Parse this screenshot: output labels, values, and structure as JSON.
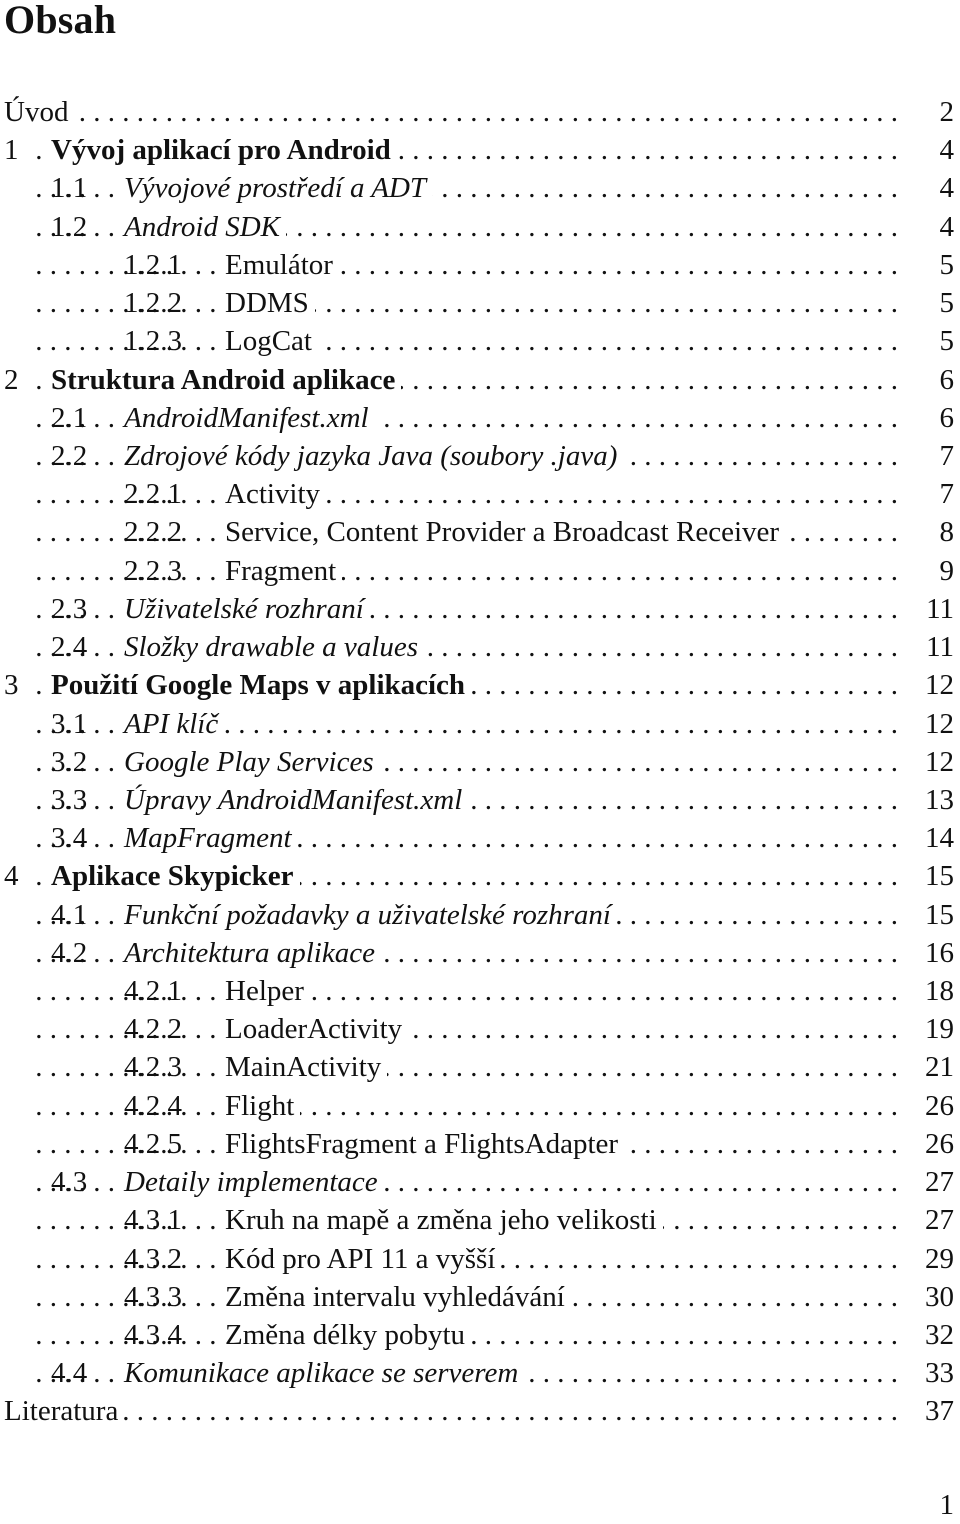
{
  "page": {
    "title": "Obsah",
    "footer_page_number": "1"
  },
  "toc": [
    {
      "level": 0,
      "number": "",
      "title": "Úvod",
      "page": "2"
    },
    {
      "level": 1,
      "number": "1",
      "title": "Vývoj aplikací pro Android",
      "page": "4"
    },
    {
      "level": 2,
      "number": "1.1",
      "title": "Vývojové prostředí a ADT",
      "page": "4"
    },
    {
      "level": 2,
      "number": "1.2",
      "title": "Android SDK",
      "page": "4"
    },
    {
      "level": 3,
      "number": "1.2.1",
      "title": "Emulátor",
      "page": "5"
    },
    {
      "level": 3,
      "number": "1.2.2",
      "title": "DDMS",
      "page": "5"
    },
    {
      "level": 3,
      "number": "1.2.3",
      "title": "LogCat",
      "page": "5"
    },
    {
      "level": 1,
      "number": "2",
      "title": "Struktura Android aplikace",
      "page": "6"
    },
    {
      "level": 2,
      "number": "2.1",
      "title": "AndroidManifest.xml",
      "page": "6"
    },
    {
      "level": 2,
      "number": "2.2",
      "title": "Zdrojové kódy jazyka Java (soubory .java)",
      "page": "7"
    },
    {
      "level": 3,
      "number": "2.2.1",
      "title": "Activity",
      "page": "7"
    },
    {
      "level": 3,
      "number": "2.2.2",
      "title": "Service, Content Provider a Broadcast Receiver",
      "page": "8"
    },
    {
      "level": 3,
      "number": "2.2.3",
      "title": "Fragment",
      "page": "9"
    },
    {
      "level": 2,
      "number": "2.3",
      "title": "Uživatelské rozhraní",
      "page": "11"
    },
    {
      "level": 2,
      "number": "2.4",
      "title": "Složky drawable a values",
      "page": "11"
    },
    {
      "level": 1,
      "number": "3",
      "title": "Použití Google Maps v aplikacích",
      "page": "12"
    },
    {
      "level": 2,
      "number": "3.1",
      "title": "API klíč",
      "page": "12"
    },
    {
      "level": 2,
      "number": "3.2",
      "title": "Google Play Services",
      "page": "12"
    },
    {
      "level": 2,
      "number": "3.3",
      "title": "Úpravy AndroidManifest.xml",
      "page": "13"
    },
    {
      "level": 2,
      "number": "3.4",
      "title": "MapFragment",
      "page": "14"
    },
    {
      "level": 1,
      "number": "4",
      "title": "Aplikace Skypicker",
      "page": "15"
    },
    {
      "level": 2,
      "number": "4.1",
      "title": "Funkční požadavky a uživatelské rozhraní",
      "page": "15"
    },
    {
      "level": 2,
      "number": "4.2",
      "title": "Architektura aplikace",
      "page": "16"
    },
    {
      "level": 3,
      "number": "4.2.1",
      "title": "Helper",
      "page": "18"
    },
    {
      "level": 3,
      "number": "4.2.2",
      "title": "LoaderActivity",
      "page": "19"
    },
    {
      "level": 3,
      "number": "4.2.3",
      "title": "MainActivity",
      "page": "21"
    },
    {
      "level": 3,
      "number": "4.2.4",
      "title": "Flight",
      "page": "26"
    },
    {
      "level": 3,
      "number": "4.2.5",
      "title": "FlightsFragment a FlightsAdapter",
      "page": "26"
    },
    {
      "level": 2,
      "number": "4.3",
      "title": "Detaily implementace",
      "page": "27"
    },
    {
      "level": 3,
      "number": "4.3.1",
      "title": "Kruh na mapě a změna jeho velikosti",
      "page": "27"
    },
    {
      "level": 3,
      "number": "4.3.2",
      "title": "Kód pro API 11 a vyšší",
      "page": "29"
    },
    {
      "level": 3,
      "number": "4.3.3",
      "title": "Změna intervalu vyhledávání",
      "page": "30"
    },
    {
      "level": 3,
      "number": "4.3.4",
      "title": "Změna délky pobytu",
      "page": "32"
    },
    {
      "level": 2,
      "number": "4.4",
      "title": "Komunikace aplikace se serverem",
      "page": "33"
    },
    {
      "level": 0,
      "number": "",
      "title": "Literatura",
      "page": "37"
    }
  ],
  "dot_leader": " . "
}
